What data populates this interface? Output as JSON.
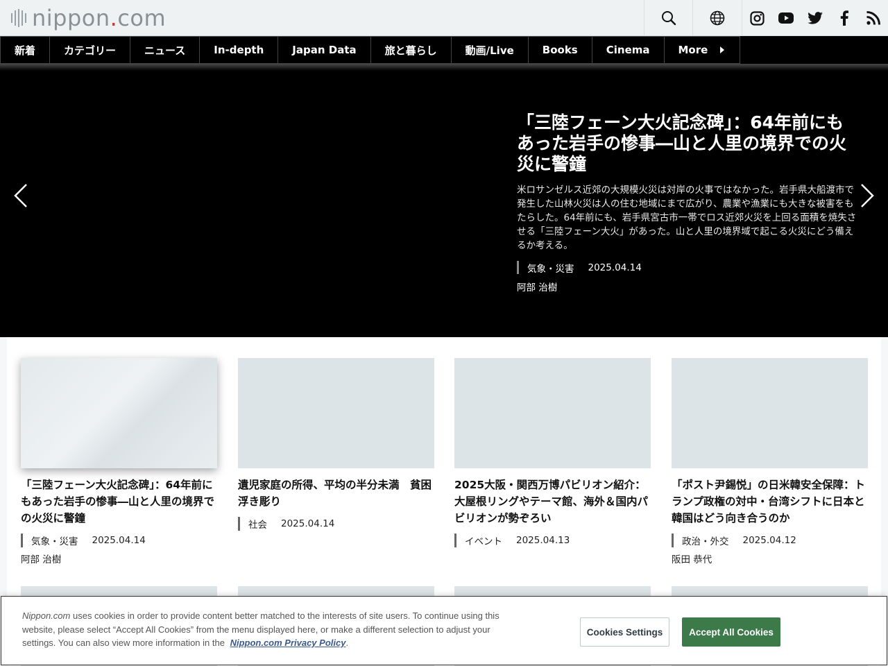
{
  "header": {
    "logo": {
      "main": "nippon",
      "dot": ".",
      "suffix": "com"
    },
    "icons": [
      "search-icon",
      "globe-icon",
      "instagram-icon",
      "youtube-icon",
      "twitter-icon",
      "facebook-icon",
      "rss-icon"
    ]
  },
  "nav": {
    "items": [
      "新着",
      "カテゴリー",
      "ニュース",
      "In-depth",
      "Japan Data",
      "旅と暮らし",
      "動画/Live",
      "Books",
      "Cinema",
      "More"
    ]
  },
  "hero": {
    "title": "「三陸フェーン大火記念碑」：64年前にもあった岩手の惨事―山と人里の境界での火災に警鐘",
    "description": "米ロサンゼルス近郊の大規模火災は対岸の火事ではなかった。岩手県大船渡市で発生した山林火災は人の住む地域にまで広がり、農業や漁業にも大きな被害をもたらした。64年前にも、岩手県宮古市一帯でロス近郊火災を上回る面積を焼失させる「三陸フェーン大火」があった。山と人里の境界域で起こる火災にどう備えるか考える。",
    "category": "気象・災害",
    "date": "2025.04.14",
    "author": "阿部 治樹"
  },
  "cards": [
    {
      "title": "「三陸フェーン大火記念碑」：64年前にもあった岩手の惨事―山と人里の境界での火災に警鐘",
      "category": "気象・災害",
      "date": "2025.04.14",
      "author": "阿部 治樹"
    },
    {
      "title": "遺児家庭の所得、平均の半分未満　貧困浮き彫り",
      "category": "社会",
      "date": "2025.04.14",
      "author": ""
    },
    {
      "title": "2025大阪・関西万博パビリオン紹介：大屋根リングやテーマ館、海外＆国内パビリオンが勢ぞろい",
      "category": "イベント",
      "date": "2025.04.13",
      "author": ""
    },
    {
      "title": "「ポスト尹錫悦」の日米韓安全保障：トランプ政権の対中・台湾シフトに日本と韓国はどう向き合うのか",
      "category": "政治・外交",
      "date": "2025.04.12",
      "author": "阪田 恭代"
    }
  ],
  "cookie": {
    "brand": "Nippon.com",
    "text": " uses cookies in order to provide content better matched to the interests of site users. To continue using this website, please select “Accept All Cookies” from the menu displayed here, or make a different selection to adjust your settings. You can also view more information in the ",
    "policy_link": "Nippon.com Privacy Policy",
    "period": ".",
    "settings_label": "Cookies Settings",
    "accept_label": "Accept All Cookies"
  },
  "colors": {
    "accent_dot": "#d0342c",
    "accept_button": "#3d7a4a",
    "policy_link": "#3a5a8c"
  }
}
